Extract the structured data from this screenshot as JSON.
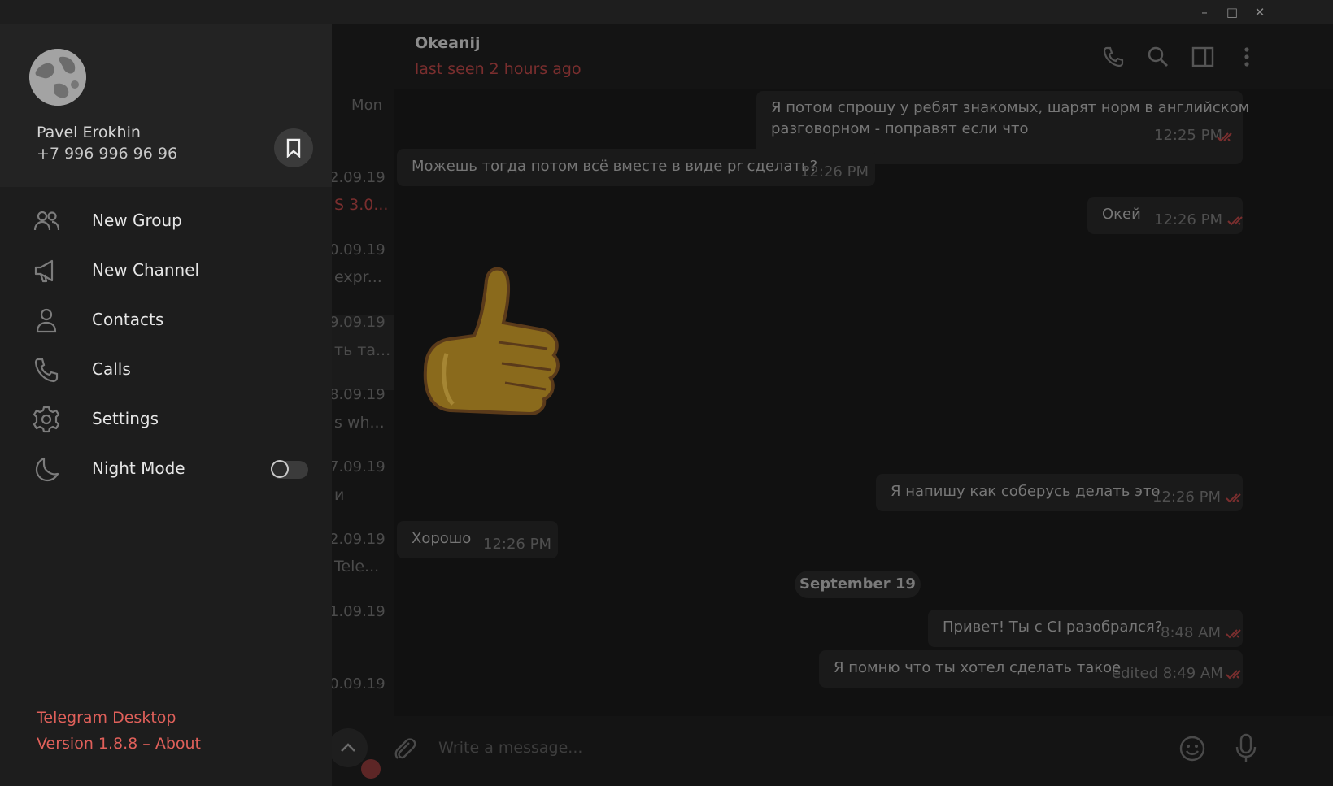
{
  "window": {
    "minimize_glyph": "–",
    "maximize_glyph": "□",
    "close_glyph": "✕"
  },
  "chat_list": {
    "dates": [
      "Mon",
      "2.09.19",
      "0.09.19",
      "9.09.19",
      "8.09.19",
      "7.09.19",
      "2.09.19",
      "1.09.19",
      "0.09.19"
    ],
    "snippets": [
      "S 3.0...",
      "expr...",
      "ть та...",
      "s wh...",
      "и",
      "Tele..."
    ]
  },
  "drawer": {
    "user": {
      "name": "Pavel Erokhin",
      "phone": "+7 996 996 96 96"
    },
    "menu": [
      {
        "label": "New Group",
        "icon": "group-icon"
      },
      {
        "label": "New Channel",
        "icon": "megaphone-icon"
      },
      {
        "label": "Contacts",
        "icon": "contact-icon"
      },
      {
        "label": "Calls",
        "icon": "phone-icon"
      },
      {
        "label": "Settings",
        "icon": "gear-icon"
      },
      {
        "label": "Night Mode",
        "icon": "moon-icon",
        "toggle": false
      }
    ],
    "footer": {
      "app": "Telegram Desktop",
      "version": "Version 1.8.8 – About"
    }
  },
  "chat": {
    "name": "Okeanij",
    "status": "last seen 2 hours ago",
    "messages": [
      {
        "dir": "out",
        "text1": "Я потом спрошу у ребят знакомых, шарят норм в английском",
        "text2": "разговорном - поправят если что",
        "time": "12:25 PM"
      },
      {
        "dir": "in",
        "text": "Можешь тогда потом всё вместе в виде pr сделать?",
        "time": "12:26 PM"
      },
      {
        "dir": "out",
        "text": "Окей",
        "time": "12:26 PM"
      },
      {
        "dir": "in",
        "sticker": "thumbs-up"
      },
      {
        "dir": "out",
        "text": "Я напишу как соберусь делать это",
        "time": "12:26 PM"
      },
      {
        "dir": "in",
        "text": "Хорошо",
        "time": "12:26 PM"
      },
      {
        "dir": "out",
        "text": "Привет! Ты с CI разобрался?",
        "time": "8:48 AM"
      },
      {
        "dir": "out",
        "text": "Я помню что ты хотел сделать такое",
        "time": "edited 8:49 AM"
      }
    ],
    "date_separator": "September 19",
    "composer_placeholder": "Write a message..."
  },
  "colors": {
    "accent": "#e0605a",
    "check": "#7a2e2e"
  }
}
